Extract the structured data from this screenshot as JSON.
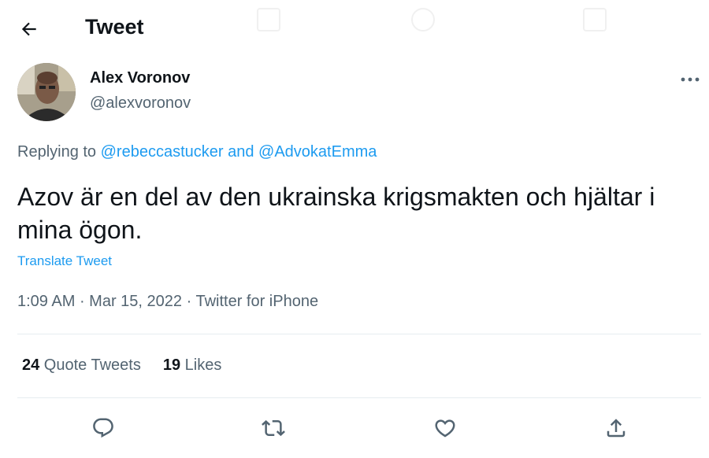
{
  "header": {
    "title": "Tweet",
    "back_icon": "arrow-left-icon"
  },
  "author": {
    "display_name": "Alex Voronov",
    "handle": "@alexvoronov"
  },
  "reply": {
    "prefix": "Replying to ",
    "user1": "@rebeccastucker",
    "conjunction": " and ",
    "user2": "@AdvokatEmma"
  },
  "tweet": {
    "text": "Azov är en del av den ukrainska krigsmakten och hjältar i mina ögon.",
    "translate_label": "Translate Tweet",
    "time": "1:09 AM",
    "separator": " · ",
    "date": "Mar 15, 2022",
    "client": "Twitter for iPhone"
  },
  "stats": {
    "quote_count": "24",
    "quote_label": " Quote Tweets",
    "like_count": "19",
    "like_label": " Likes"
  },
  "actions": [
    "reply-icon",
    "retweet-icon",
    "like-icon",
    "share-icon"
  ],
  "colors": {
    "link": "#1d9bf0",
    "secondary_text": "#536471",
    "primary_text": "#0f1419",
    "divider": "#e6ecf0"
  }
}
